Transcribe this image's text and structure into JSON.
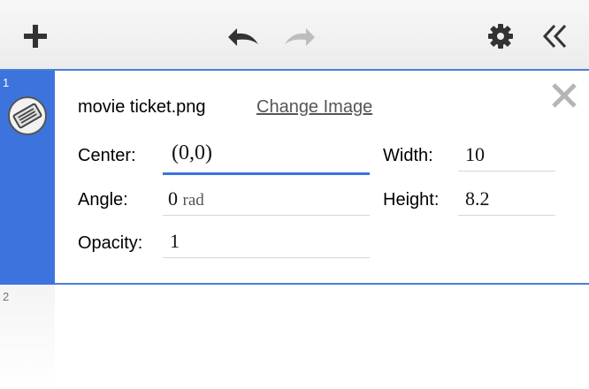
{
  "toolbar": {
    "add_icon": "plus-icon",
    "undo_icon": "undo-icon",
    "redo_icon": "redo-icon",
    "settings_icon": "gear-icon",
    "collapse_icon": "double-chevron-left-icon"
  },
  "expressions": [
    {
      "index": "1",
      "type": "image",
      "filename": "movie ticket.png",
      "change_label": "Change Image",
      "fields": {
        "center_label": "Center:",
        "center_value": "(0,0)",
        "angle_label": "Angle:",
        "angle_value": "0",
        "angle_unit": "rad",
        "opacity_label": "Opacity:",
        "opacity_value": "1",
        "width_label": "Width:",
        "width_value": "10",
        "height_label": "Height:",
        "height_value": "8.2"
      }
    },
    {
      "index": "2"
    }
  ],
  "colors": {
    "accent": "#3d73dc",
    "toolbar_bg": "#f2f2f2"
  }
}
